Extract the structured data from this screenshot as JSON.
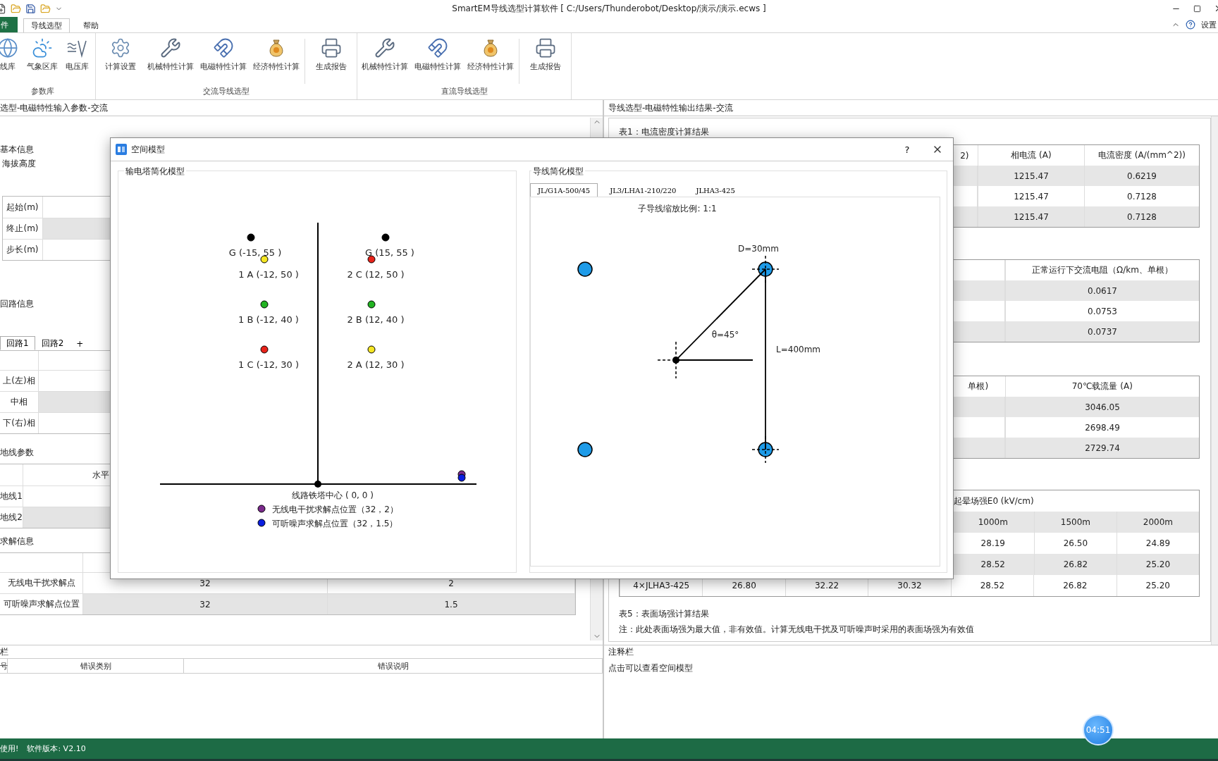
{
  "title_bar": {
    "title": "SmartEM导线选型计算软件  [  C:/Users/Thunderobot/Desktop/演示/演示.ecws  ]"
  },
  "ribbon": {
    "tabs": [
      {
        "label": "件",
        "kind": "file",
        "selected": false
      },
      {
        "label": "导线选型",
        "kind": "tab",
        "selected": true
      },
      {
        "label": "帮助",
        "kind": "tab",
        "selected": false
      }
    ],
    "settings_label": "设置",
    "groups": [
      {
        "label": "参数库",
        "items": [
          {
            "label": "线库",
            "kind": "globe"
          },
          {
            "label": "气象区库",
            "kind": "weather"
          },
          {
            "label": "电压库",
            "kind": "voltage"
          }
        ]
      },
      {
        "label": "交流导线选型",
        "items": [
          {
            "label": "计算设置",
            "kind": "settings"
          },
          {
            "label": "机械特性计算",
            "kind": "tools"
          },
          {
            "label": "电磁特性计算",
            "kind": "magnet"
          },
          {
            "label": "经济特性计算",
            "kind": "money_bag"
          },
          {
            "label": "生成报告",
            "kind": "printer"
          }
        ]
      },
      {
        "label": "直流导线选型",
        "items": [
          {
            "label": "机械特性计算",
            "kind": "tools"
          },
          {
            "label": "电磁特性计算",
            "kind": "magnet"
          },
          {
            "label": "经济特性计算",
            "kind": "money_bag"
          },
          {
            "label": "生成报告",
            "kind": "printer"
          }
        ]
      }
    ]
  },
  "input_panel": {
    "header": "选型-电磁特性输入参数-交流",
    "basic_info": {
      "title": "基本信息",
      "altitude_label": "海拔高度",
      "range_rows": [
        "起始(m)",
        "终止(m)",
        "步长(m)"
      ]
    },
    "circuit_info": {
      "title": "回路信息",
      "tabs": [
        {
          "label": "回路1",
          "selected": true
        },
        {
          "label": "回路2",
          "selected": false
        }
      ],
      "add_tab": "+",
      "rows": [
        "上(左)相",
        "中相",
        "下(右)相"
      ]
    },
    "ground_wire": {
      "title": "地线参数",
      "column": "水平",
      "rows": [
        "地线1",
        "地线2"
      ]
    },
    "solve_info": {
      "title": "求解信息",
      "rows": [
        [
          "无线电干扰求解点",
          "32",
          "2"
        ],
        [
          "可听噪声求解点位置",
          "32",
          "1.5"
        ]
      ]
    }
  },
  "output_panel": {
    "header": "导线选型-电磁特性输出结果-交流",
    "table1": {
      "title": "表1：电流密度计算结果",
      "columns": [
        "2)",
        "相电流 (A)",
        "电流密度 (A/(mm^2))"
      ],
      "rows": [
        [
          "",
          "1215.47",
          "0.6219"
        ],
        [
          "",
          "1215.47",
          "0.7128"
        ],
        [
          "",
          "1215.47",
          "0.7128"
        ]
      ]
    },
    "table2": {
      "columns": [
        "正常运行下交流电阻（Ω/km、单根）"
      ],
      "rows": [
        [
          "0.0617"
        ],
        [
          "0.0753"
        ],
        [
          "0.0737"
        ]
      ]
    },
    "table3": {
      "columns": [
        "单根)",
        "70℃载流量 (A)"
      ],
      "rows": [
        [
          "",
          "3046.05"
        ],
        [
          "",
          "2698.49"
        ],
        [
          "",
          "2729.74"
        ]
      ]
    },
    "table4": {
      "group_header": "起晕场强E0 (kV/cm)",
      "subcolumns": [
        "1000m",
        "1500m",
        "2000m"
      ],
      "rows": [
        [
          "28.19",
          "26.50",
          "24.89"
        ],
        [
          "28.52",
          "26.82",
          "25.20"
        ],
        [
          "4×JLHA3-425",
          "26.80",
          "32.22",
          "30.32",
          "28.52",
          "26.82",
          "25.20"
        ]
      ]
    },
    "table5_title": "表5：表面场强计算结果",
    "note": "注：此处表面场强为最大值，非有效值。计算无线电干扰及可听噪声时采用的表面场强为有效值"
  },
  "dialog": {
    "title": "空间模型",
    "help": "?",
    "tower_model": {
      "title": "输电塔简化模型",
      "points": [
        {
          "label": "G (-15, 55 )",
          "color": "#000000"
        },
        {
          "label": "1 A (-12, 50 )",
          "color": "#f5e623"
        },
        {
          "label": "1 B (-12, 40 )",
          "color": "#22b322"
        },
        {
          "label": "1 C (-12, 30 )",
          "color": "#e8231a"
        },
        {
          "label": "G (15, 55 )",
          "color": "#000000"
        },
        {
          "label": "2 C (12, 50 )",
          "color": "#e8231a"
        },
        {
          "label": "2 B (12, 40 )",
          "color": "#22b322"
        },
        {
          "label": "2 A (12, 30 )",
          "color": "#f5e623"
        }
      ],
      "center_label": "线路铁塔中心 ( 0, 0 )",
      "legend": [
        {
          "label": "无线电干扰求解点位置（32，2）",
          "color": "#7b2a8c"
        },
        {
          "label": "可听噪声求解点位置（32，1.5）",
          "color": "#0a1ee0"
        }
      ]
    },
    "bundle_model": {
      "title": "导线简化模型",
      "tabs": [
        {
          "label": "JL/G1A-500/45",
          "selected": true
        },
        {
          "label": "JL3/LHA1-210/220",
          "selected": false
        },
        {
          "label": "JLHA3-425",
          "selected": false
        }
      ],
      "scale_label": "子导线缩放比例: 1:1",
      "diameter_label": "D=30mm",
      "angle_label": "θ=45°",
      "spacing_label": "L=400mm"
    }
  },
  "error_panel": {
    "header": "栏",
    "columns": [
      "号",
      "错误类别",
      "错误说明"
    ]
  },
  "notes_panel": {
    "header": "注释栏",
    "text": "点击可以查看空间模型"
  },
  "status_bar": {
    "items": [
      "使用!",
      "软件版本: V2.10"
    ]
  },
  "recording_timer": "04:51"
}
